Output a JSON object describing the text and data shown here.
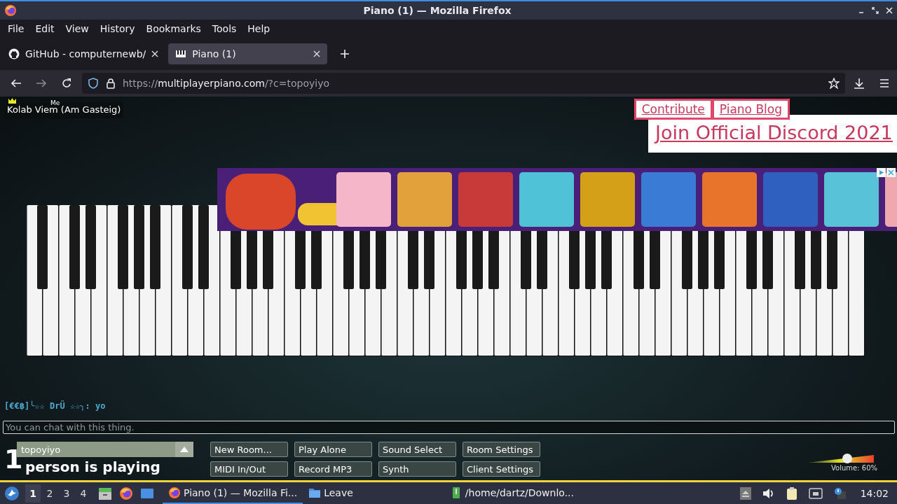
{
  "window": {
    "title": "Piano (1) — Mozilla Firefox"
  },
  "menu": [
    "File",
    "Edit",
    "View",
    "History",
    "Bookmarks",
    "Tools",
    "Help"
  ],
  "tabs": [
    {
      "label": "GitHub - computernewb/",
      "selected": false,
      "kind": "github"
    },
    {
      "label": "Piano (1)",
      "selected": true,
      "kind": "piano"
    }
  ],
  "address": {
    "scheme": "https://",
    "domain": "multiplayerpiano.com",
    "path": "/?c=topoyiyo"
  },
  "users": [
    {
      "name": "Kolab Viem (Am Gasteig)",
      "tag": "Me",
      "owner": true
    }
  ],
  "links": [
    "Contribute",
    "Piano Blog"
  ],
  "discord_link": "Join Official Discord 2021",
  "chat": {
    "messages": [
      {
        "text": "[€€฿]╰☆☆ DrÜ ☆☆╮: yo"
      }
    ],
    "placeholder": "You can chat with this thing."
  },
  "player_count": {
    "number": "1",
    "label": "person is playing"
  },
  "room_name": "topoyiyo",
  "buttons": [
    "New Room...",
    "Play Alone",
    "Sound Select",
    "Room Settings",
    "MIDI In/Out",
    "Record MP3",
    "Synth",
    "Client Settings"
  ],
  "volume": {
    "level": 0.6,
    "reading": "Volume: 60%"
  },
  "taskbar": {
    "workspaces": [
      {
        "label": "1",
        "selected": true
      },
      {
        "label": "2",
        "selected": false
      },
      {
        "label": "3",
        "selected": false
      },
      {
        "label": "4",
        "selected": false
      }
    ],
    "windows": [
      {
        "label": "Piano (1) — Mozilla Fi...",
        "selected": true,
        "kind": "browser"
      },
      {
        "label": "Leave",
        "selected": false,
        "kind": "folder"
      },
      {
        "label": "/home/dartz/Downlo...",
        "selected": false,
        "kind": "archive"
      }
    ],
    "clock": "14:02"
  }
}
